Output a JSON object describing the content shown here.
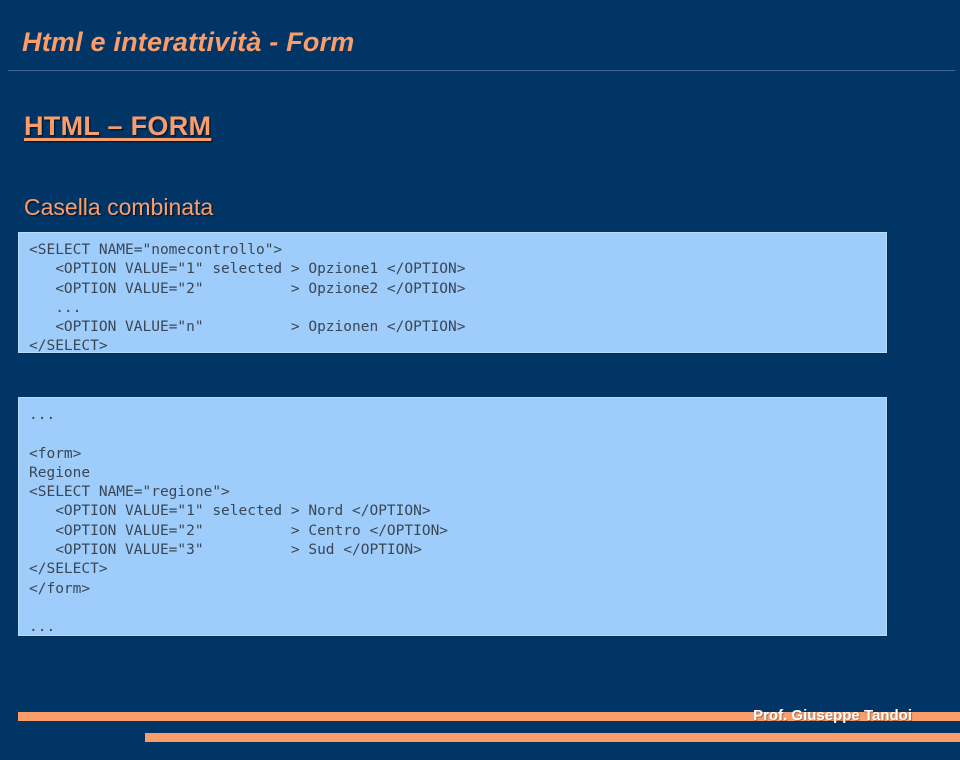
{
  "slide": {
    "title": "Html e interattività - Form",
    "heading_main": "HTML – FORM",
    "heading_sub": "Casella combinata",
    "background_color": "#003566",
    "accent_color": "#FB9D6B",
    "code_block_color": "#9FCDFB",
    "code_text_color": "#3a4653"
  },
  "code_blocks": [
    {
      "id": "code-block-1",
      "lines": [
        "<SELECT NAME=\"nomecontrollo\">",
        "   <OPTION VALUE=\"1\" selected > Opzione1 </OPTION>",
        "   <OPTION VALUE=\"2\"          > Opzione2 </OPTION>",
        "   ...",
        "   <OPTION VALUE=\"n\"          > Opzionen </OPTION>",
        "</SELECT>"
      ]
    },
    {
      "id": "code-block-2",
      "lines": [
        "...",
        "",
        "<form>",
        "Regione",
        "<SELECT NAME=\"regione\">",
        "   <OPTION VALUE=\"1\" selected > Nord </OPTION>",
        "   <OPTION VALUE=\"2\"          > Centro </OPTION>",
        "   <OPTION VALUE=\"3\"          > Sud </OPTION>",
        "</SELECT>",
        "</form>",
        "",
        "..."
      ]
    }
  ],
  "footer": {
    "author": "Prof. Giuseppe Tandoi",
    "bar_color": "#FB9D6B"
  }
}
